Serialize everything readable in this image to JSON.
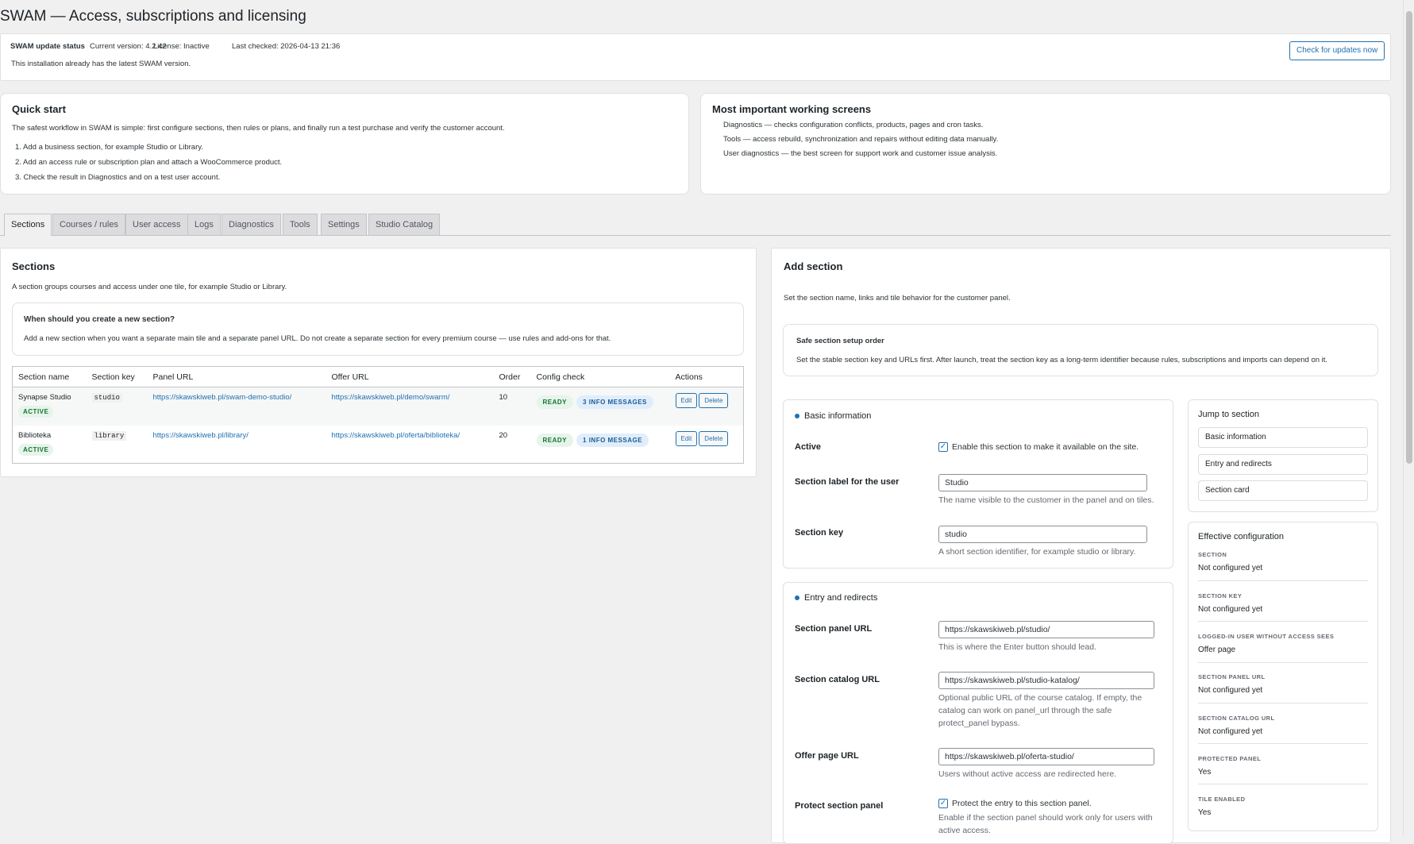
{
  "page_title": "SWAM — Access, subscriptions and licensing",
  "update": {
    "label": "SWAM update status",
    "current_version": "Current version: 4.2.42",
    "license": "License: Inactive",
    "last_checked": "Last checked: 2026-04-13 21:36",
    "message": "This installation already has the latest SWAM version.",
    "check_button": "Check for updates now"
  },
  "quick_start": {
    "title": "Quick start",
    "intro": "The safest workflow in SWAM is simple: first configure sections, then rules or plans, and finally run a test purchase and verify the customer account.",
    "steps": [
      "1. Add a business section, for example Studio or Library.",
      "2. Add an access rule or subscription plan and attach a WooCommerce product.",
      "3. Check the result in Diagnostics and on a test user account."
    ]
  },
  "screens": {
    "title": "Most important working screens",
    "items": [
      "Diagnostics — checks configuration conflicts, products, pages and cron tasks.",
      "Tools — access rebuild, synchronization and repairs without editing data manually.",
      "User diagnostics — the best screen for support work and customer issue analysis."
    ]
  },
  "tabs": [
    "Sections",
    "Courses / rules",
    "User access",
    "Logs",
    "Diagnostics",
    "Tools",
    "Settings",
    "Studio Catalog"
  ],
  "sections_panel": {
    "title": "Sections",
    "description": "A section groups courses and access under one tile, for example Studio or Library.",
    "hint_title": "When should you create a new section?",
    "hint_text": "Add a new section when you want a separate main tile and a separate panel URL. Do not create a separate section for every premium course — use rules and add-ons for that.",
    "columns": [
      "Section name",
      "Section key",
      "Panel URL",
      "Offer URL",
      "Order",
      "Config check",
      "Actions"
    ],
    "rows": [
      {
        "name": "Synapse Studio",
        "status": "ACTIVE",
        "key": "studio",
        "panel_url": "https://skawskiweb.pl/swam-demo-studio/",
        "offer_url": "https://skawskiweb.pl/demo/swarm/",
        "order": "10",
        "ready": "READY",
        "info": "3 INFO MESSAGES",
        "edit": "Edit",
        "delete": "Delete"
      },
      {
        "name": "Biblioteka",
        "status": "ACTIVE",
        "key": "library",
        "panel_url": "https://skawskiweb.pl/library/",
        "offer_url": "https://skawskiweb.pl/oferta/biblioteka/",
        "order": "20",
        "ready": "READY",
        "info": "1 INFO MESSAGE",
        "edit": "Edit",
        "delete": "Delete"
      }
    ]
  },
  "add_section": {
    "title": "Add section",
    "description": "Set the section name, links and tile behavior for the customer panel.",
    "safe_title": "Safe section setup order",
    "safe_text": "Set the stable section key and URLs first. After launch, treat the section key as a long-term identifier because rules, subscriptions and imports can depend on it.",
    "basic": {
      "title": "Basic information",
      "active_label": "Active",
      "active_text": "Enable this section to make it available on the site.",
      "label_label": "Section label for the user",
      "label_value": "Studio",
      "label_desc": "The name visible to the customer in the panel and on tiles.",
      "key_label": "Section key",
      "key_value": "studio",
      "key_desc": "A short section identifier, for example studio or library."
    },
    "entry": {
      "title": "Entry and redirects",
      "panel_label": "Section panel URL",
      "panel_value": "https://skawskiweb.pl/studio/",
      "panel_desc": "This is where the Enter button should lead.",
      "catalog_label": "Section catalog URL",
      "catalog_value": "https://skawskiweb.pl/studio-katalog/",
      "catalog_desc": "Optional public URL of the course catalog. If empty, the catalog can work on panel_url through the safe protect_panel bypass.",
      "offer_label": "Offer page URL",
      "offer_value": "https://skawskiweb.pl/oferta-studio/",
      "offer_desc": "Users without active access are redirected here.",
      "protect_label": "Protect section panel",
      "protect_text": "Protect the entry to this section panel.",
      "protect_desc": "Enable if the section panel should work only for users with active access."
    }
  },
  "jump": {
    "title": "Jump to section",
    "items": [
      "Basic information",
      "Entry and redirects",
      "Section card"
    ]
  },
  "effective": {
    "title": "Effective configuration",
    "items": [
      {
        "k": "SECTION",
        "v": "Not configured yet"
      },
      {
        "k": "SECTION KEY",
        "v": "Not configured yet"
      },
      {
        "k": "LOGGED-IN USER WITHOUT ACCESS SEES",
        "v": "Offer page"
      },
      {
        "k": "SECTION PANEL URL",
        "v": "Not configured yet"
      },
      {
        "k": "SECTION CATALOG URL",
        "v": "Not configured yet"
      },
      {
        "k": "PROTECTED PANEL",
        "v": "Yes"
      },
      {
        "k": "TILE ENABLED",
        "v": "Yes"
      }
    ]
  },
  "colors": {
    "accent": "#2271b1",
    "ready": "#137333",
    "info": "#1e5a96",
    "page_bg": "#f0f0f1"
  }
}
